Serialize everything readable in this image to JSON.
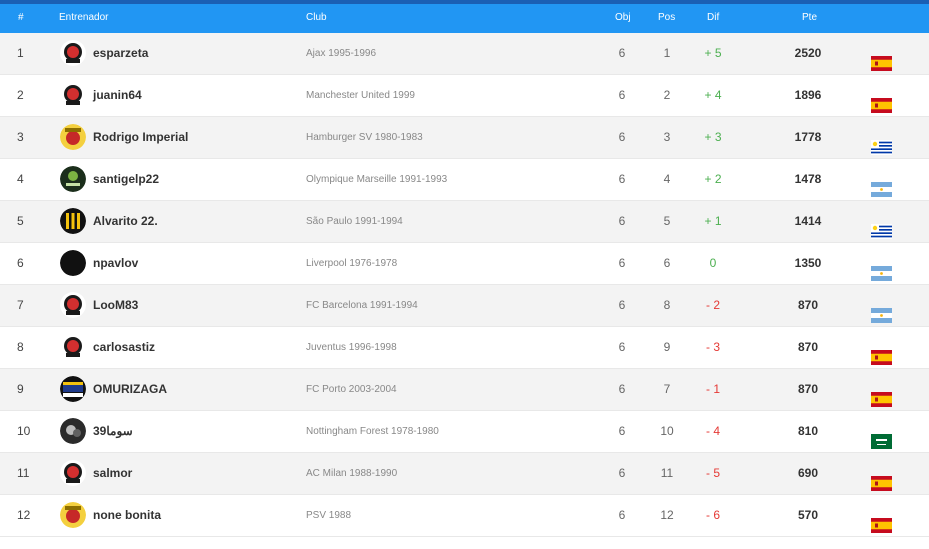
{
  "header": {
    "rank": "#",
    "coach": "Entrenador",
    "club": "Club",
    "obj": "Obj",
    "pos": "Pos",
    "dif": "Dif",
    "pts": "Pte"
  },
  "rows": [
    {
      "rank": "1",
      "name": "esparzeta",
      "club": "Ajax 1995-1996",
      "obj": "6",
      "pos": "1",
      "dif": "+ 5",
      "pts": "2520",
      "flag": "spain-flag",
      "avatar": "red-team-badge-icon"
    },
    {
      "rank": "2",
      "name": "juanin64",
      "club": "Manchester United 1999",
      "obj": "6",
      "pos": "2",
      "dif": "+ 4",
      "pts": "1896",
      "flag": "spain-flag",
      "avatar": "red-team-badge-icon"
    },
    {
      "rank": "3",
      "name": "Rodrigo Imperial",
      "club": "Hamburger SV 1980-1983",
      "obj": "6",
      "pos": "3",
      "dif": "+ 3",
      "pts": "1778",
      "flag": "uruguay-flag",
      "avatar": "yellow-red-badge-icon"
    },
    {
      "rank": "4",
      "name": "santigelp22",
      "club": "Olympique Marseille 1991-1993",
      "obj": "6",
      "pos": "4",
      "dif": "+ 2",
      "pts": "1478",
      "flag": "argentina-flag",
      "avatar": "dark-green-badge-icon"
    },
    {
      "rank": "5",
      "name": "Alvarito 22.",
      "club": "São Paulo 1991-1994",
      "obj": "6",
      "pos": "5",
      "dif": "+ 1",
      "pts": "1414",
      "flag": "uruguay-flag",
      "avatar": "yellow-black-stripes-badge-icon"
    },
    {
      "rank": "6",
      "name": "npavlov",
      "club": "Liverpool 1976-1978",
      "obj": "6",
      "pos": "6",
      "dif": "0",
      "pts": "1350",
      "flag": "argentina-flag",
      "avatar": "black-circle-avatar-icon"
    },
    {
      "rank": "7",
      "name": "LooM83",
      "club": "FC Barcelona 1991-1994",
      "obj": "6",
      "pos": "8",
      "dif": "- 2",
      "pts": "870",
      "flag": "argentina-flag",
      "avatar": "red-team-badge-icon"
    },
    {
      "rank": "8",
      "name": "carlosastiz",
      "club": "Juventus 1996-1998",
      "obj": "6",
      "pos": "9",
      "dif": "- 3",
      "pts": "870",
      "flag": "spain-flag",
      "avatar": "red-team-badge-icon"
    },
    {
      "rank": "9",
      "name": "OMURIZAGA",
      "club": "FC Porto 2003-2004",
      "obj": "6",
      "pos": "7",
      "dif": "- 1",
      "pts": "870",
      "flag": "spain-flag",
      "avatar": "blue-yellow-badge-icon"
    },
    {
      "rank": "10",
      "name": "سوما39",
      "club": "Nottingham Forest 1978-1980",
      "obj": "6",
      "pos": "10",
      "dif": "- 4",
      "pts": "810",
      "flag": "saudi-arabia-flag",
      "avatar": "dark-photo-avatar-icon"
    },
    {
      "rank": "11",
      "name": "salmor",
      "club": "AC Milan 1988-1990",
      "obj": "6",
      "pos": "11",
      "dif": "- 5",
      "pts": "690",
      "flag": "spain-flag",
      "avatar": "red-team-badge-icon"
    },
    {
      "rank": "12",
      "name": "none bonita",
      "club": "PSV 1988",
      "obj": "6",
      "pos": "12",
      "dif": "- 6",
      "pts": "570",
      "flag": "spain-flag",
      "avatar": "yellow-red-badge-icon"
    }
  ]
}
